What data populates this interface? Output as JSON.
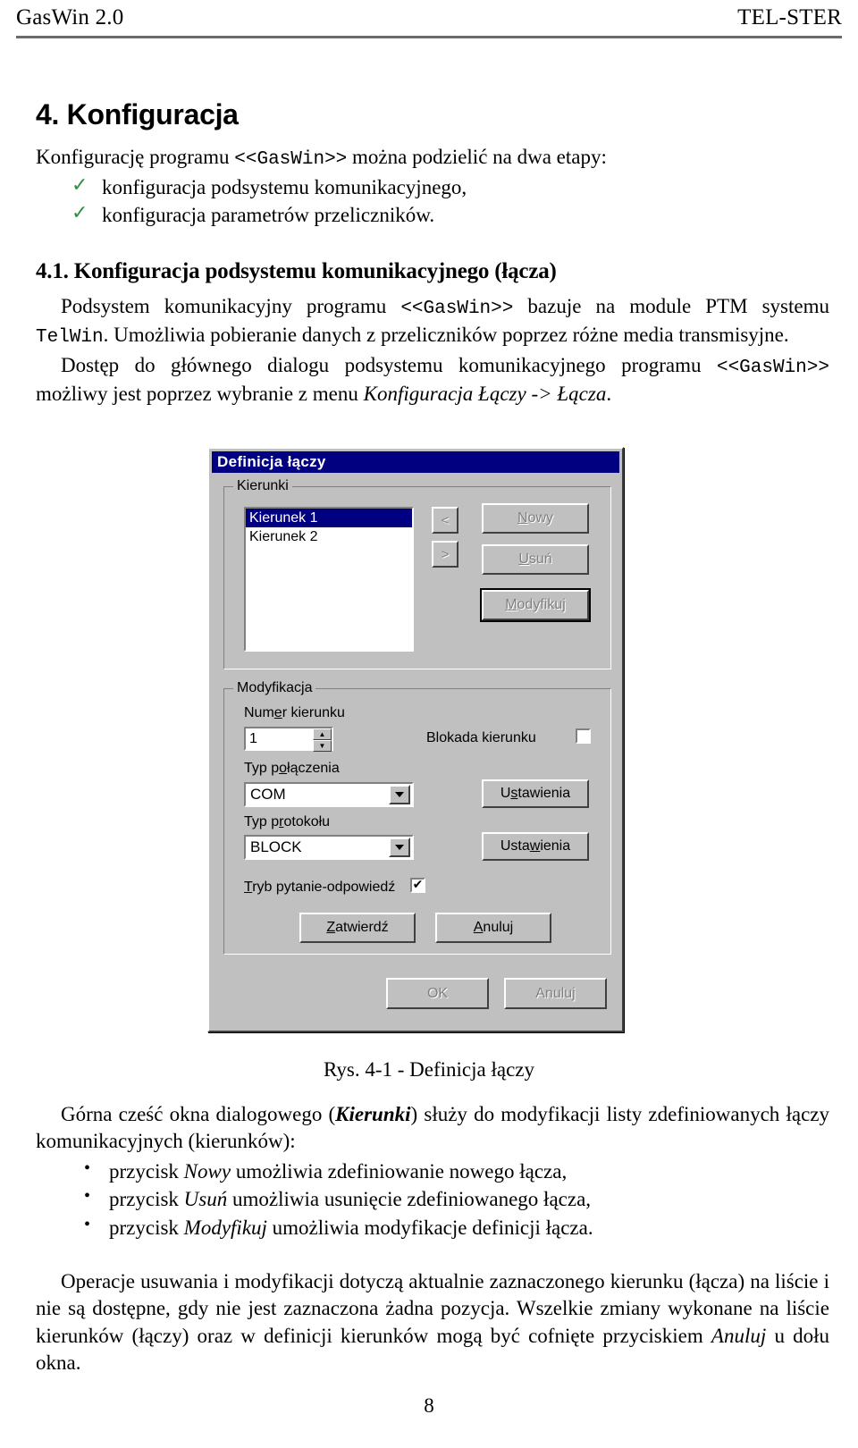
{
  "header": {
    "left": "GasWin 2.0",
    "right": "TEL-STER"
  },
  "section4": {
    "heading": "4. Konfiguracja",
    "intro_a": "Konfigurację programu ",
    "intro_mono": "<<GasWin>>",
    "intro_b": "  można podzielić na dwa etapy:",
    "checkmark": "✓",
    "bullets": [
      "konfiguracja podsystemu komunikacyjnego,",
      "konfiguracja parametrów przeliczników."
    ]
  },
  "section41": {
    "heading": "4.1. Konfiguracja podsystemu komunikacyjnego (łącza)",
    "p1_a": "Podsystem komunikacyjny programu ",
    "p1_mono1": "<<GasWin>>",
    "p1_b": "  bazuje na module PTM systemu ",
    "p1_mono2": "TelWin",
    "p1_c": ". Umożliwia pobieranie danych z przeliczników poprzez różne media transmisyjne.",
    "p2_a": "Dostęp do głównego dialogu podsystemu komunikacyjnego programu ",
    "p2_mono": "<<GasWin>>",
    "p2_b": " możliwy jest poprzez wybranie z menu ",
    "p2_italic": "Konfiguracja Łączy -> Łącza",
    "p2_c": "."
  },
  "dialog": {
    "title": "Definicja łączy",
    "group_kierunki": {
      "label": "Kierunki",
      "list_items": [
        {
          "label": "Kierunek 1",
          "selected": true
        },
        {
          "label": "Kierunek 2",
          "selected": false
        }
      ],
      "arrow_prev": "<",
      "arrow_next": ">",
      "buttons": [
        {
          "pre": "N",
          "mnemonic": "",
          "label_full": "Nowy",
          "accel": "N",
          "rest": "owy",
          "disabled": true
        },
        {
          "label_full": "Usuń",
          "accel": "U",
          "rest": "suń",
          "disabled": true
        },
        {
          "label_full": "Modyfikuj",
          "accel": "M",
          "rest": "odyfikuj",
          "disabled": true
        }
      ]
    },
    "group_modyfikacja": {
      "label": "Modyfikacja",
      "numer_label_a": "Num",
      "numer_accel": "e",
      "numer_label_b": "r kierunku",
      "numer_value": "1",
      "spin_up": "▲",
      "spin_down": "▼",
      "blokada_label": "Blokada kierunku",
      "blokada_checked": false,
      "blokada_mark": "",
      "typ_polaczenia_a": "Typ p",
      "typ_polaczenia_accel": "o",
      "typ_polaczenia_b": "łączenia",
      "typ_polaczenia_value": "COM",
      "ustawienia1_accel": "s",
      "ustawienia1_pre": "U",
      "ustawienia1_post": "tawienia",
      "typ_protokolu_a": "Typ p",
      "typ_protokolu_accel": "r",
      "typ_protokolu_b": "otokołu",
      "typ_protokolu_value": "BLOCK",
      "ustawienia2_pre": "Usta",
      "ustawienia2_accel": "w",
      "ustawienia2_post": "ienia",
      "tryb_pre": "T",
      "tryb_accel": "",
      "tryb_label": "Tryb pytanie-odpowiedź",
      "tryb_rest": "ryb pytanie-odpowiedź",
      "tryb_checked": true,
      "tryb_mark": "✔",
      "zatwierdz_pre": "Z",
      "zatwierdz_rest": "atwierdź",
      "anuluj_pre": "A",
      "anuluj_rest": "nuluj"
    },
    "footer": {
      "ok_label": "OK",
      "cancel_label": "Anuluj",
      "ok_disabled": true,
      "cancel_disabled": true
    }
  },
  "caption": "Rys. 4-1 - Definicja łączy",
  "after_figure": {
    "p1_a": "Górna cześć okna dialogowego (",
    "p1_bolditalic": "Kierunki",
    "p1_b": ") służy do modyfikacji listy zdefiniowanych łączy komunikacyjnych (kierunków):",
    "bullet_dot": "•",
    "bullets": [
      {
        "a": "przycisk ",
        "i": "Nowy",
        "b": " umożliwia zdefiniowanie nowego łącza,"
      },
      {
        "a": "przycisk ",
        "i": "Usuń",
        "b": " umożliwia usunięcie zdefiniowanego łącza,"
      },
      {
        "a": "przycisk ",
        "i": "Modyfikuj",
        "b": " umożliwia modyfikacje definicji łącza."
      }
    ],
    "p2_a": "Operacje usuwania i modyfikacji dotyczą aktualnie zaznaczonego kierunku (łącza) na liście i nie są dostępne, gdy nie jest zaznaczona żadna pozycja. Wszelkie zmiany wykonane na liście kierunków (łączy) oraz w definicji kierunków mogą być cofnięte przyciskiem ",
    "p2_italic": "Anuluj",
    "p2_b": " u dołu okna."
  },
  "page_number": "8",
  "colors": {
    "titlebar": "#000080",
    "face": "#c0c0c0",
    "check_green": "#2f8f3f",
    "rule": "#6b6b6b"
  }
}
